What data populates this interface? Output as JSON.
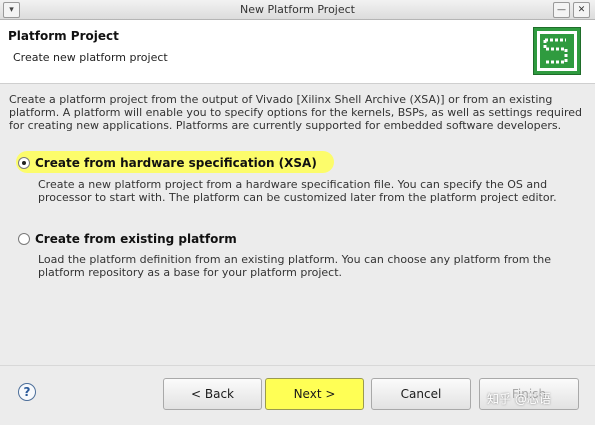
{
  "window": {
    "title": "New Platform Project",
    "menu_glyph": "▾",
    "min_glyph": "—",
    "close_glyph": "✕"
  },
  "header": {
    "title": "Platform Project",
    "subtitle": "Create new platform project",
    "logo_icon": "xilinx-platform-logo-icon"
  },
  "intro_text": "Create a platform project from the output of Vivado [Xilinx Shell Archive (XSA)] or from an existing platform. A platform will enable you to specify options for the kernels, BSPs, as well as settings required for creating new applications. Platforms are currently supported for embedded software developers.",
  "options": [
    {
      "label": "Create from hardware specification (XSA)",
      "selected": true,
      "description": "Create a new platform project from a hardware specification file. You can specify the OS and processor to start with. The platform can be customized later from the platform project editor."
    },
    {
      "label": "Create from existing platform",
      "selected": false,
      "description": "Load the platform definition from an existing platform. You can choose any platform from the platform repository as a base for your platform project."
    }
  ],
  "footer": {
    "help_glyph": "?",
    "back_label": "< Back",
    "next_label": "Next >",
    "cancel_label": "Cancel",
    "finish_label": "Finish"
  },
  "watermark": "知乎 @芯语",
  "colors": {
    "highlight": "#ffff55",
    "logo_green": "#2f9b3f"
  }
}
